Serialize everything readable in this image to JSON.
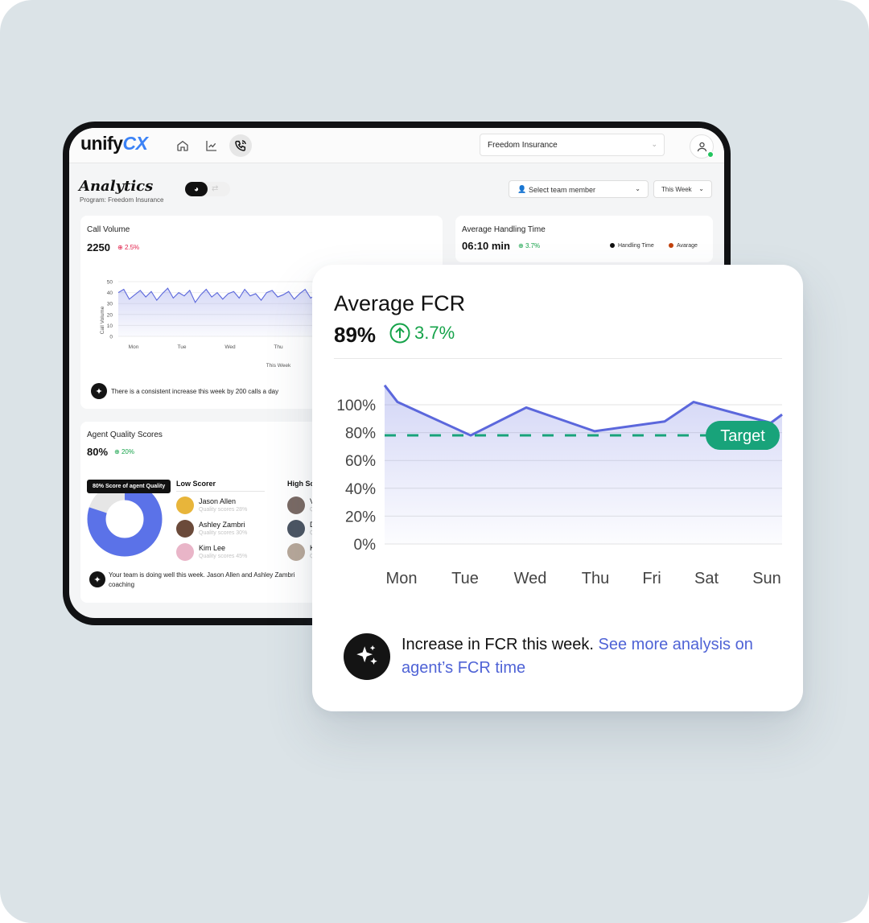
{
  "app": {
    "logo_prefix": "unify",
    "logo_suffix": "CX",
    "program_select": "Freedom Insurance"
  },
  "nav": [
    {
      "name": "home-icon"
    },
    {
      "name": "trend-chart-icon"
    },
    {
      "name": "phone-call-icon",
      "active": true
    }
  ],
  "page": {
    "title": "Analytics",
    "subtitle": "Program: Freedom Insurance",
    "team_placeholder": "Select team member",
    "period": "This Week"
  },
  "call_volume": {
    "title": "Call Volume",
    "value": "2250",
    "delta": "2.5%",
    "ylabel": "Call Volume",
    "xlabel": "This Week",
    "yticks": [
      "50",
      "40",
      "30",
      "20",
      "10",
      "0"
    ],
    "xticks": [
      "Mon",
      "Tue",
      "Wed",
      "Thu"
    ],
    "insight": "There is a consistent increase this week by 200 calls a day",
    "chart_data": {
      "type": "area",
      "y_range": [
        0,
        50
      ],
      "values": [
        40,
        43,
        34,
        38,
        42,
        36,
        41,
        33,
        39,
        44,
        35,
        40,
        37,
        42,
        31,
        38,
        43,
        36,
        40,
        34,
        39,
        41,
        35,
        43,
        37,
        39,
        33,
        40,
        42,
        36,
        38,
        41,
        34,
        39,
        43,
        35,
        38,
        40,
        30,
        37,
        42,
        39,
        33,
        41,
        36,
        29,
        40,
        38,
        43,
        35,
        39,
        42,
        37,
        34,
        40,
        36,
        41,
        38,
        35,
        39
      ]
    }
  },
  "aht": {
    "title": "Average Handling Time",
    "value": "06:10 min",
    "delta": "3.7%",
    "legend": [
      {
        "label": "Handling Time",
        "color": "#111111"
      },
      {
        "label": "Avarage",
        "color": "#c2410c"
      }
    ]
  },
  "quality": {
    "title": "Agent Quality Scores",
    "value": "80%",
    "delta": "20%",
    "tooltip": "80% Score of agent Quality",
    "donut_value": 80,
    "low_head": "Low Scorer",
    "high_head": "High Sc",
    "low_scorers": [
      {
        "name": "Jason Allen",
        "score": "Quality scores 28%",
        "avatar_color": "#e8b53a"
      },
      {
        "name": "Ashley Zambri",
        "score": "Quality scores 30%",
        "avatar_color": "#6b4a3a"
      },
      {
        "name": "Kim Lee",
        "score": "Quality scores 45%",
        "avatar_color": "#e9b5c8"
      }
    ],
    "high_scorers": [
      {
        "name": "V",
        "score": "Q",
        "avatar_color": "#7a6a64"
      },
      {
        "name": "D",
        "score": "Q",
        "avatar_color": "#4b5563"
      },
      {
        "name": "K",
        "score": "Q",
        "avatar_color": "#b8a89a"
      }
    ],
    "insight_line1": "Your team is doing well this week. Jason Allen and Ashley Zambri",
    "insight_line2": "coaching"
  },
  "fcr": {
    "title": "Average FCR",
    "value": "89%",
    "delta": "3.7%",
    "target_label": "Target",
    "insight_text": "Increase in FCR this week. ",
    "insight_link": "See more analysis on agent’s FCR time",
    "chart_data": {
      "type": "area",
      "categories": [
        "Mon",
        "Tue",
        "Wed",
        "Thu",
        "Fri",
        "Sat",
        "Sun"
      ],
      "yticks": [
        "100%",
        "80%",
        "60%",
        "40%",
        "20%",
        "0%"
      ],
      "y_range": [
        0,
        100
      ],
      "points": [
        {
          "x": "Mon",
          "y": 114
        },
        {
          "x": "Mon",
          "y": 102
        },
        {
          "x": "Tue",
          "y": 78
        },
        {
          "x": "Wed",
          "y": 98
        },
        {
          "x": "Thu",
          "y": 81
        },
        {
          "x": "Fri",
          "y": 88
        },
        {
          "x": "Sat",
          "y": 102
        },
        {
          "x": "Sun",
          "y": 87
        },
        {
          "x": "Sun",
          "y": 93
        }
      ],
      "target": 78,
      "colors": {
        "line": "#5b67dc",
        "target": "#18a37a"
      }
    }
  }
}
